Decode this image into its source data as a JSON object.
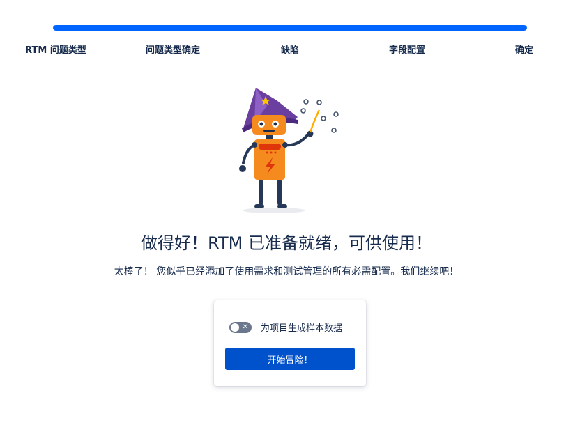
{
  "progress": {
    "value": 1.0,
    "color": "#0065ff",
    "steps": [
      {
        "label": "RTM 问题类型"
      },
      {
        "label": "问题类型确定"
      },
      {
        "label": "缺陷"
      },
      {
        "label": "字段配置"
      },
      {
        "label": "确定"
      }
    ]
  },
  "illustration": {
    "icon": "wizard-robot-illustration"
  },
  "main": {
    "title": "做得好！RTM 已准备就绪，可供使用！",
    "subtitle": "太棒了！ 您似乎已经添加了使用需求和测试管理的所有必需配置。我们继续吧！"
  },
  "card": {
    "toggle_label": "为项目生成样本数据",
    "toggle_on": false,
    "button_label": "开始冒险！",
    "button_color": "#0052cc"
  }
}
